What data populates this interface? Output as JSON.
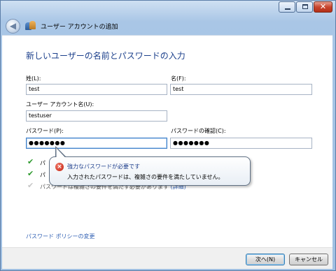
{
  "window": {
    "title": "ユーザー アカウントの追加",
    "close_glyph": "✕"
  },
  "nav": {
    "back_glyph": "◀"
  },
  "heading": "新しいユーザーの名前とパスワードの入力",
  "form": {
    "last_name_label": "姓(L):",
    "last_name_value": "test",
    "first_name_label": "名(F):",
    "first_name_value": "test",
    "account_label": "ユーザー アカウント名(U):",
    "account_value": "testuser",
    "password_label": "パスワード(P):",
    "password_value": "●●●●●●●",
    "confirm_label": "パスワードの確認(C):",
    "confirm_value": "●●●●●●●"
  },
  "requirements": {
    "row1_prefix": "パ",
    "row2_prefix": "パ",
    "row3_text": "パスワードは複雑さの要件を満たす必要があります",
    "details_link": "(詳細)",
    "check_glyph": "✔"
  },
  "balloon": {
    "error_glyph": "×",
    "title": "強力なパスワードが必要です",
    "message": "入力されたパスワードは、複雑さの要件を満たしていません。"
  },
  "policy_link": "パスワード ポリシーの変更",
  "buttons": {
    "next": "次へ(N)",
    "cancel": "キャンセル"
  },
  "colors": {
    "link": "#2f5fb3",
    "heading": "#1b3f8b",
    "check_ok": "#2e9a2e",
    "error": "#c11d0c"
  }
}
